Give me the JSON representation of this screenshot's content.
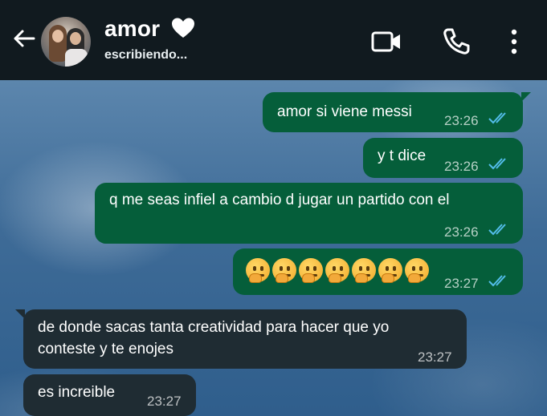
{
  "header": {
    "contact_name": "amor",
    "status": "escribiendo...",
    "background_color": "#111a1f",
    "icons": [
      "back-arrow-icon",
      "heart-icon",
      "video-call-icon",
      "phone-icon",
      "more-options-icon"
    ]
  },
  "messages": [
    {
      "direction": "outgoing",
      "text": "amor si viene messi",
      "time": "23:26",
      "status": "read"
    },
    {
      "direction": "outgoing",
      "text": "y t dice",
      "time": "23:26",
      "status": "read"
    },
    {
      "direction": "outgoing",
      "text": "q me seas infiel a cambio d jugar un partido con el",
      "time": "23:26",
      "status": "read"
    },
    {
      "direction": "outgoing",
      "text": "🤔🤔🤔🤔🤔🤔🤔",
      "emoji_count": 7,
      "emoji_name": "thinking-face",
      "time": "23:27",
      "status": "read"
    },
    {
      "direction": "incoming",
      "text": "de donde sacas tanta creatividad para hacer que yo contesté y te enojes",
      "line1": "de donde sacas tanta creatividad para hacer que yo",
      "line2": "conteste y te enojes",
      "time": "23:27"
    },
    {
      "direction": "incoming",
      "text": "es increible",
      "time": "23:27"
    }
  ],
  "colors": {
    "outgoing_bubble": "#055e3a",
    "incoming_bubble": "#1f2c33",
    "read_ticks": "#53bdeb"
  }
}
